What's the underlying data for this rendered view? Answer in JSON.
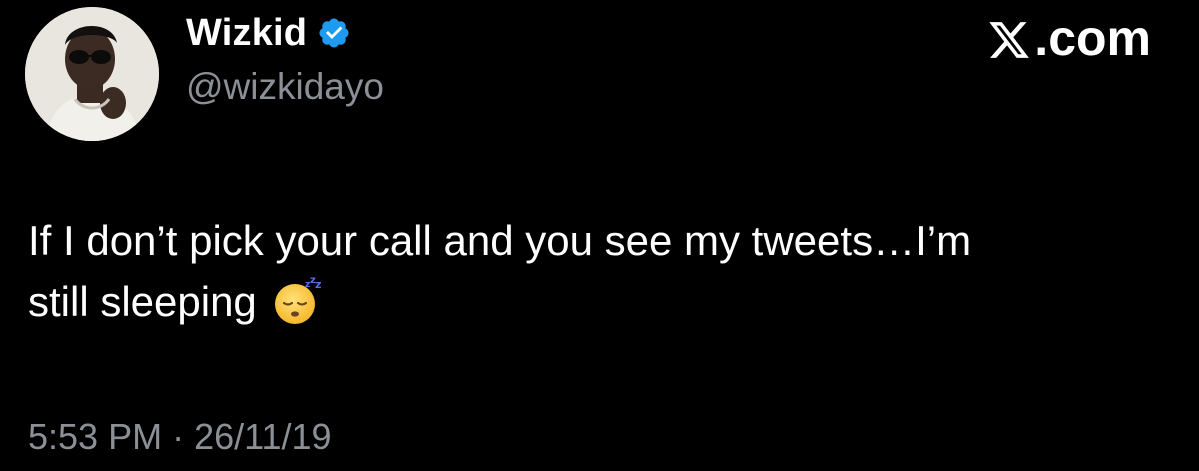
{
  "author": {
    "display_name": "Wizkid",
    "handle": "@wizkidayo",
    "verified": true,
    "verified_color": "#1d9bf0"
  },
  "brand": {
    "domain_text": ".com",
    "logo_icon": "x-logo-icon"
  },
  "tweet": {
    "text_line_1": "If I don’t pick your call and you see my tweets…I’m",
    "text_line_2": "still sleeping",
    "emoji": "sleeping-face-emoji"
  },
  "meta": {
    "time": "5:53 PM",
    "separator": "·",
    "date": "26/11/19"
  },
  "colors": {
    "background": "#000000",
    "primary_text": "#ffffff",
    "secondary_text": "#8b9096"
  }
}
